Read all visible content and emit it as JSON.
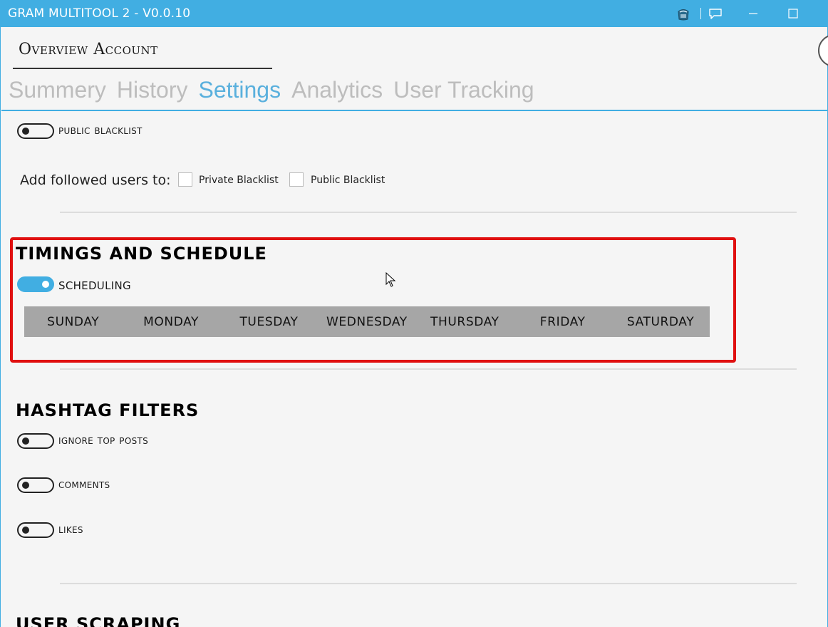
{
  "window": {
    "title": "GRAM MULTITOOL 2 - V0.0.10",
    "controls": {
      "minimize": "—",
      "maximize": "☐"
    },
    "icons": [
      "paint-bucket-icon",
      "chat-bubble-icon",
      "minimize-icon",
      "maximize-icon"
    ]
  },
  "account": {
    "title_first_letter": "O",
    "title_rest_1": "verview ",
    "title_second_letter": "A",
    "title_rest_2": "ccount"
  },
  "tabs": [
    {
      "label": "Summery",
      "active": false
    },
    {
      "label": "History",
      "active": false
    },
    {
      "label": "Settings",
      "active": true
    },
    {
      "label": "Analytics",
      "active": false
    },
    {
      "label": "User Tracking",
      "active": false
    }
  ],
  "blacklist": {
    "public_blacklist_label": "public blacklist",
    "public_blacklist_on": false,
    "add_followed_label": "Add followed users to:",
    "private_blacklist_cb": "Private Blacklist",
    "public_blacklist_cb": "Public Blacklist"
  },
  "timings": {
    "title": "TIMINGS AND SCHEDULE",
    "scheduling_label": "SCHEDULING",
    "scheduling_on": true,
    "days": [
      "SUNDAY",
      "MONDAY",
      "TUESDAY",
      "WEDNESDAY",
      "THURSDAY",
      "FRIDAY",
      "SATURDAY"
    ]
  },
  "hashtag": {
    "title": "HASHTAG FILTERS",
    "toggles": [
      {
        "label": "ignore top posts",
        "on": false
      },
      {
        "label": "comments",
        "on": false
      },
      {
        "label": "likes",
        "on": false
      }
    ]
  },
  "user_scraping": {
    "title": "USER SCRAPING"
  },
  "colors": {
    "accent": "#41aee2",
    "highlight_border": "#e01010",
    "days_bar": "#a6a6a6"
  }
}
